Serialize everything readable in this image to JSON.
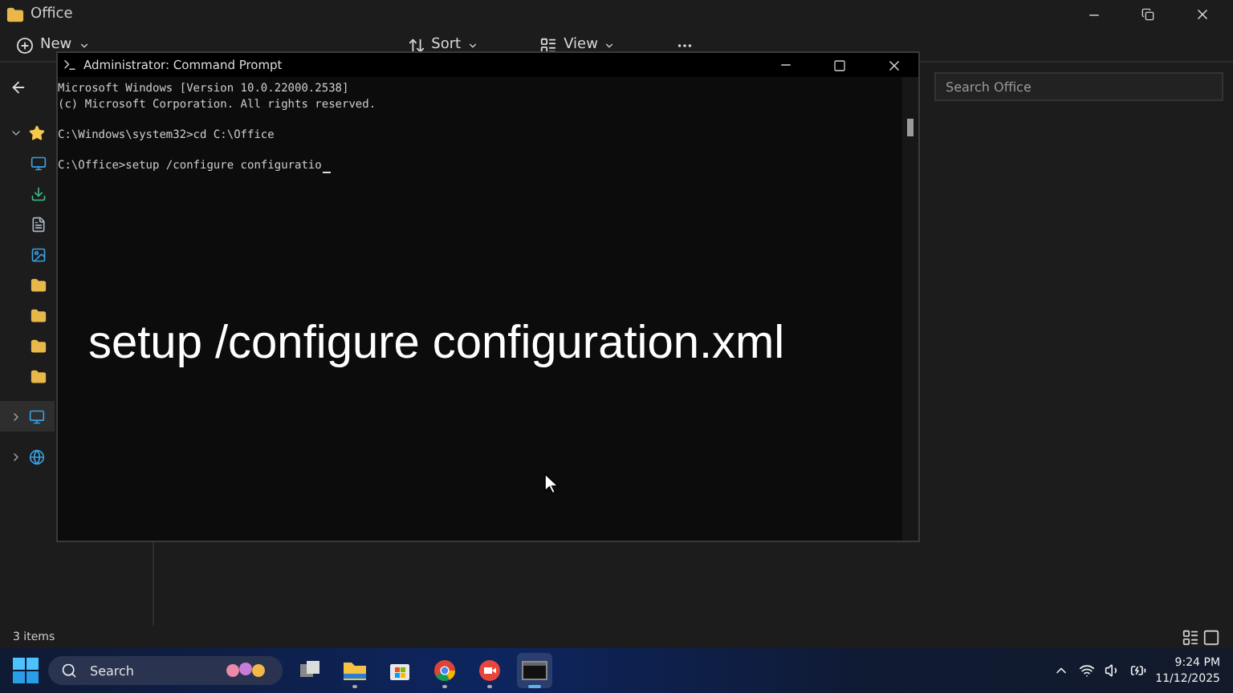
{
  "explorer": {
    "title": "Office",
    "toolbar": [
      {
        "kind": "new",
        "label": "New"
      },
      {
        "kind": "sort",
        "label": "Sort"
      },
      {
        "kind": "view",
        "label": "View"
      },
      {
        "kind": "more"
      }
    ],
    "search": {
      "placeholder": "Search Office"
    },
    "sidebar": [
      {
        "kind": "star",
        "expanded": true,
        "selected": false,
        "children": [
          {
            "kind": "desktop",
            "selected": false
          },
          {
            "kind": "download",
            "selected": false
          },
          {
            "kind": "document",
            "selected": false
          },
          {
            "kind": "pictures",
            "selected": false
          },
          {
            "kind": "folder",
            "selected": false
          },
          {
            "kind": "folder",
            "selected": false
          },
          {
            "kind": "folder",
            "selected": false
          },
          {
            "kind": "folder",
            "selected": false
          }
        ]
      },
      {
        "kind": "pc",
        "expanded": false,
        "selected": true
      },
      {
        "kind": "network",
        "expanded": false,
        "selected": false
      }
    ],
    "status": "3 items"
  },
  "console": {
    "title": "Administrator: Command Prompt",
    "blocks": [
      [
        "Microsoft Windows [Version 10.0.22000.2538]",
        "(c) Microsoft Corporation. All rights reserved."
      ],
      [
        "C:\\Windows\\system32>cd C:\\Office"
      ],
      [
        "C:\\Office>setup /configure configuratio"
      ]
    ]
  },
  "caption": "setup /configure configuration.xml",
  "taskbar": {
    "search": {
      "placeholder": "Search"
    },
    "apps": [
      {
        "kind": "taskview",
        "running": false,
        "selected": false
      },
      {
        "kind": "explorer",
        "running": true,
        "selected": false
      },
      {
        "kind": "store",
        "running": false,
        "selected": false
      },
      {
        "kind": "chrome",
        "running": true,
        "selected": false
      },
      {
        "kind": "camera",
        "running": true,
        "selected": false
      },
      {
        "kind": "terminal",
        "running": true,
        "selected": true
      }
    ],
    "time": "9:24 PM",
    "date": "11/12/2025"
  }
}
